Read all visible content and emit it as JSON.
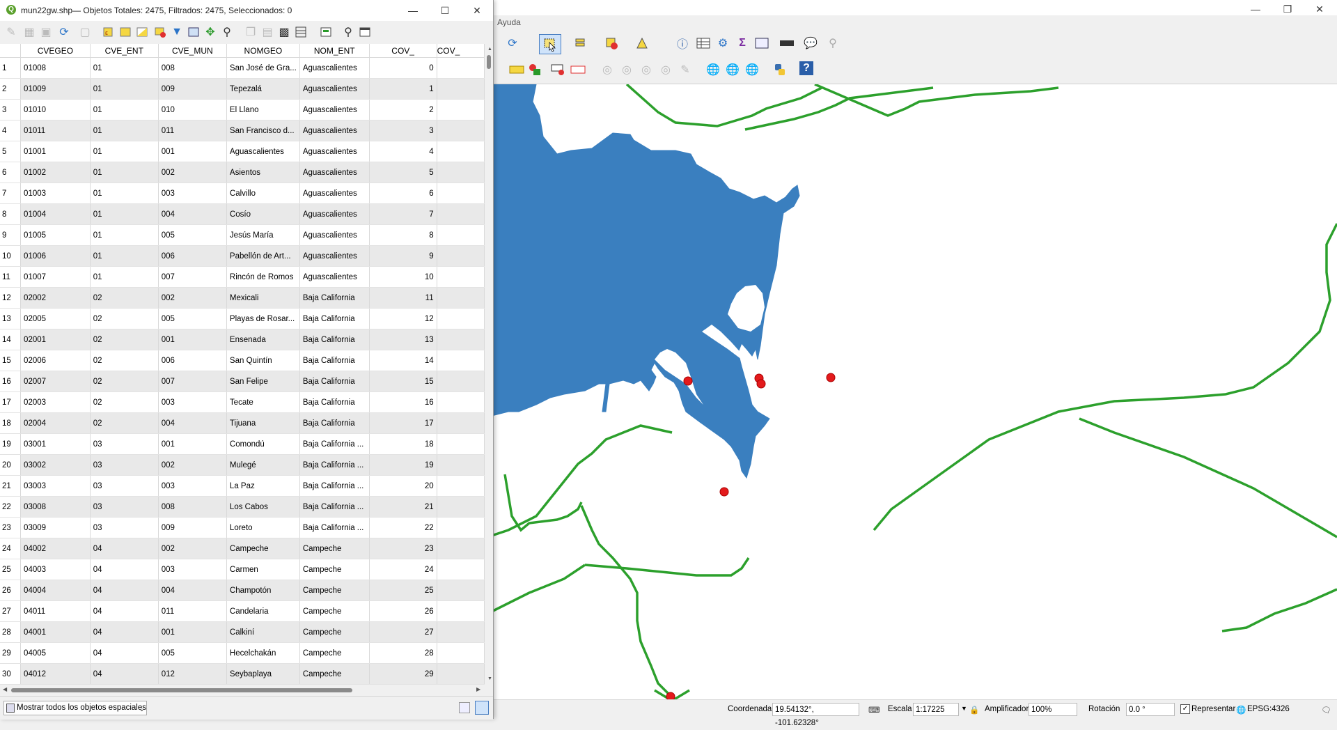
{
  "main": {
    "menu": {
      "help": "Ayuda"
    },
    "colors": {
      "water": "#3a7fbf",
      "roads": "#2ca02c",
      "points": "#e31a1c",
      "background": "#ffffff"
    },
    "statusbar": {
      "coord_label": "Coordenada",
      "coord_value": "19.54132°, -101.62328°",
      "scale_label": "Escala",
      "scale_value": "1:17225",
      "magnifier_label": "Amplificador",
      "magnifier_value": "100%",
      "rotation_label": "Rotación",
      "rotation_value": "0.0 °",
      "render_label": "Representar",
      "crs": "EPSG:4326"
    }
  },
  "attr": {
    "title": "mun22gw.shp— Objetos Totales: 2475, Filtrados: 2475, Seleccionados: 0",
    "filter_label": "Mostrar todos los objetos espaciales",
    "columns": [
      "CVEGEO",
      "CVE_ENT",
      "CVE_MUN",
      "NOMGEO",
      "NOM_ENT",
      "COV_",
      "COV_"
    ],
    "rows": [
      [
        "1",
        "01008",
        "01",
        "008",
        "San José de Gra...",
        "Aguascalientes",
        "0"
      ],
      [
        "2",
        "01009",
        "01",
        "009",
        "Tepezalá",
        "Aguascalientes",
        "1"
      ],
      [
        "3",
        "01010",
        "01",
        "010",
        "El Llano",
        "Aguascalientes",
        "2"
      ],
      [
        "4",
        "01011",
        "01",
        "011",
        "San Francisco d...",
        "Aguascalientes",
        "3"
      ],
      [
        "5",
        "01001",
        "01",
        "001",
        "Aguascalientes",
        "Aguascalientes",
        "4"
      ],
      [
        "6",
        "01002",
        "01",
        "002",
        "Asientos",
        "Aguascalientes",
        "5"
      ],
      [
        "7",
        "01003",
        "01",
        "003",
        "Calvillo",
        "Aguascalientes",
        "6"
      ],
      [
        "8",
        "01004",
        "01",
        "004",
        "Cosío",
        "Aguascalientes",
        "7"
      ],
      [
        "9",
        "01005",
        "01",
        "005",
        "Jesús María",
        "Aguascalientes",
        "8"
      ],
      [
        "10",
        "01006",
        "01",
        "006",
        "Pabellón de Art...",
        "Aguascalientes",
        "9"
      ],
      [
        "11",
        "01007",
        "01",
        "007",
        "Rincón de Romos",
        "Aguascalientes",
        "10"
      ],
      [
        "12",
        "02002",
        "02",
        "002",
        "Mexicali",
        "Baja California",
        "11"
      ],
      [
        "13",
        "02005",
        "02",
        "005",
        "Playas de Rosar...",
        "Baja California",
        "12"
      ],
      [
        "14",
        "02001",
        "02",
        "001",
        "Ensenada",
        "Baja California",
        "13"
      ],
      [
        "15",
        "02006",
        "02",
        "006",
        "San Quintín",
        "Baja California",
        "14"
      ],
      [
        "16",
        "02007",
        "02",
        "007",
        "San Felipe",
        "Baja California",
        "15"
      ],
      [
        "17",
        "02003",
        "02",
        "003",
        "Tecate",
        "Baja California",
        "16"
      ],
      [
        "18",
        "02004",
        "02",
        "004",
        "Tijuana",
        "Baja California",
        "17"
      ],
      [
        "19",
        "03001",
        "03",
        "001",
        "Comondú",
        "Baja California ...",
        "18"
      ],
      [
        "20",
        "03002",
        "03",
        "002",
        "Mulegé",
        "Baja California ...",
        "19"
      ],
      [
        "21",
        "03003",
        "03",
        "003",
        "La Paz",
        "Baja California ...",
        "20"
      ],
      [
        "22",
        "03008",
        "03",
        "008",
        "Los Cabos",
        "Baja California ...",
        "21"
      ],
      [
        "23",
        "03009",
        "03",
        "009",
        "Loreto",
        "Baja California ...",
        "22"
      ],
      [
        "24",
        "04002",
        "04",
        "002",
        "Campeche",
        "Campeche",
        "23"
      ],
      [
        "25",
        "04003",
        "04",
        "003",
        "Carmen",
        "Campeche",
        "24"
      ],
      [
        "26",
        "04004",
        "04",
        "004",
        "Champotón",
        "Campeche",
        "25"
      ],
      [
        "27",
        "04011",
        "04",
        "011",
        "Candelaria",
        "Campeche",
        "26"
      ],
      [
        "28",
        "04001",
        "04",
        "001",
        "Calkiní",
        "Campeche",
        "27"
      ],
      [
        "29",
        "04005",
        "04",
        "005",
        "Hecelchakán",
        "Campeche",
        "28"
      ],
      [
        "30",
        "04012",
        "04",
        "012",
        "Seybaplaya",
        "Campeche",
        "29"
      ]
    ]
  }
}
